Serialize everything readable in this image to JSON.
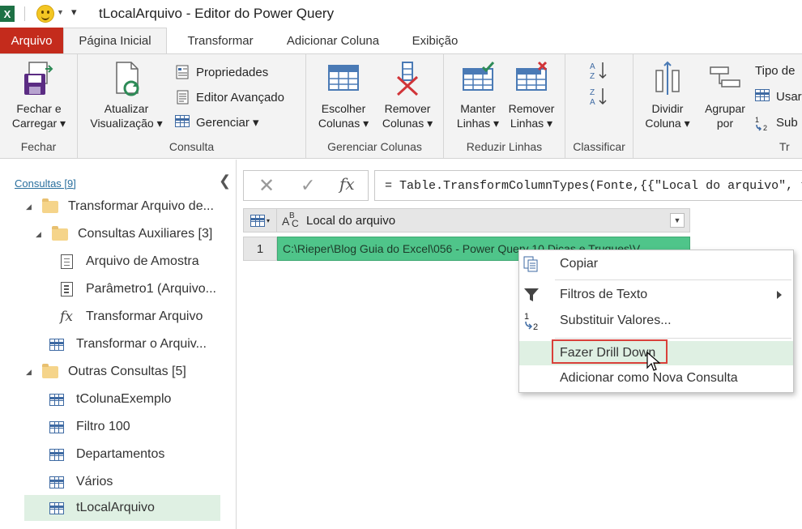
{
  "window": {
    "title": "tLocalArquivo - Editor do Power Query",
    "app_logo": "X"
  },
  "tabs": [
    {
      "label": "Arquivo"
    },
    {
      "label": "Página Inicial"
    },
    {
      "label": "Transformar"
    },
    {
      "label": "Adicionar Coluna"
    },
    {
      "label": "Exibição"
    }
  ],
  "ribbon": {
    "fechar": {
      "btn1": "Fechar e",
      "btn2": "Carregar ▾",
      "group": "Fechar"
    },
    "consulta": {
      "atualizar1": "Atualizar",
      "atualizar2": "Visualização ▾",
      "propriedades": "Propriedades",
      "editor": "Editor Avançado",
      "gerenciar": "Gerenciar ▾",
      "group": "Consulta"
    },
    "colunas": {
      "escolher1": "Escolher",
      "escolher2": "Colunas ▾",
      "remover1": "Remover",
      "remover2": "Colunas ▾",
      "group": "Gerenciar Colunas"
    },
    "linhas": {
      "manter1": "Manter",
      "manter2": "Linhas ▾",
      "remover1": "Remover",
      "remover2": "Linhas ▾",
      "group": "Reduzir Linhas"
    },
    "classificar": {
      "group": "Classificar"
    },
    "transformar": {
      "dividir1": "Dividir",
      "dividir2": "Coluna ▾",
      "agrupar1": "Agrupar",
      "agrupar2": "por",
      "tipo": "Tipo de",
      "usar": "Usar",
      "sub": "Sub",
      "group": "Tr"
    }
  },
  "left_pane": {
    "header": "Consultas [9]",
    "items": [
      {
        "label": "Transformar Arquivo de...",
        "icon": "folder-icon"
      },
      {
        "label": "Consultas Auxiliares [3]",
        "icon": "folder-icon"
      },
      {
        "label": "Arquivo de Amostra",
        "icon": "document-icon"
      },
      {
        "label": "Parâmetro1 (Arquivo...",
        "icon": "parameter-icon"
      },
      {
        "label": "Transformar Arquivo",
        "icon": "function-icon"
      },
      {
        "label": "Transformar o Arquiv...",
        "icon": "table-icon"
      },
      {
        "label": "Outras Consultas [5]",
        "icon": "folder-icon"
      },
      {
        "label": "tColunaExemplo",
        "icon": "table-icon"
      },
      {
        "label": "Filtro 100",
        "icon": "table-icon"
      },
      {
        "label": "Departamentos",
        "icon": "table-icon"
      },
      {
        "label": "Vários",
        "icon": "table-icon"
      },
      {
        "label": "tLocalArquivo",
        "icon": "table-icon",
        "selected": true
      }
    ]
  },
  "formula_bar": {
    "formula": "= Table.TransformColumnTypes(Fonte,{{\"Local do arquivo\", type text}})",
    "fx": "fx"
  },
  "grid": {
    "type_icon": "ABC",
    "columns": [
      "Local do arquivo"
    ],
    "rows": [
      {
        "num": "1",
        "value": "C:\\Rieper\\Blog Guia do Excel\\056 - Power Query 10 Dicas e Truques\\V"
      }
    ]
  },
  "context_menu": {
    "items": [
      {
        "label": "Copiar",
        "icon": "copy-icon"
      },
      {
        "label": "Filtros de Texto",
        "icon": "filter-icon",
        "submenu": true
      },
      {
        "label": "Substituir Valores...",
        "icon": "replace-values-icon"
      },
      {
        "label": "Fazer Drill Down",
        "icon": "",
        "highlighted": true
      },
      {
        "label": "Adicionar como Nova Consulta",
        "icon": ""
      }
    ]
  },
  "colors": {
    "file_tab": "#c42b1c",
    "selected_cell": "#4fc58a",
    "selection_highlight": "#dff0e3",
    "callout_border": "#d9403a"
  }
}
